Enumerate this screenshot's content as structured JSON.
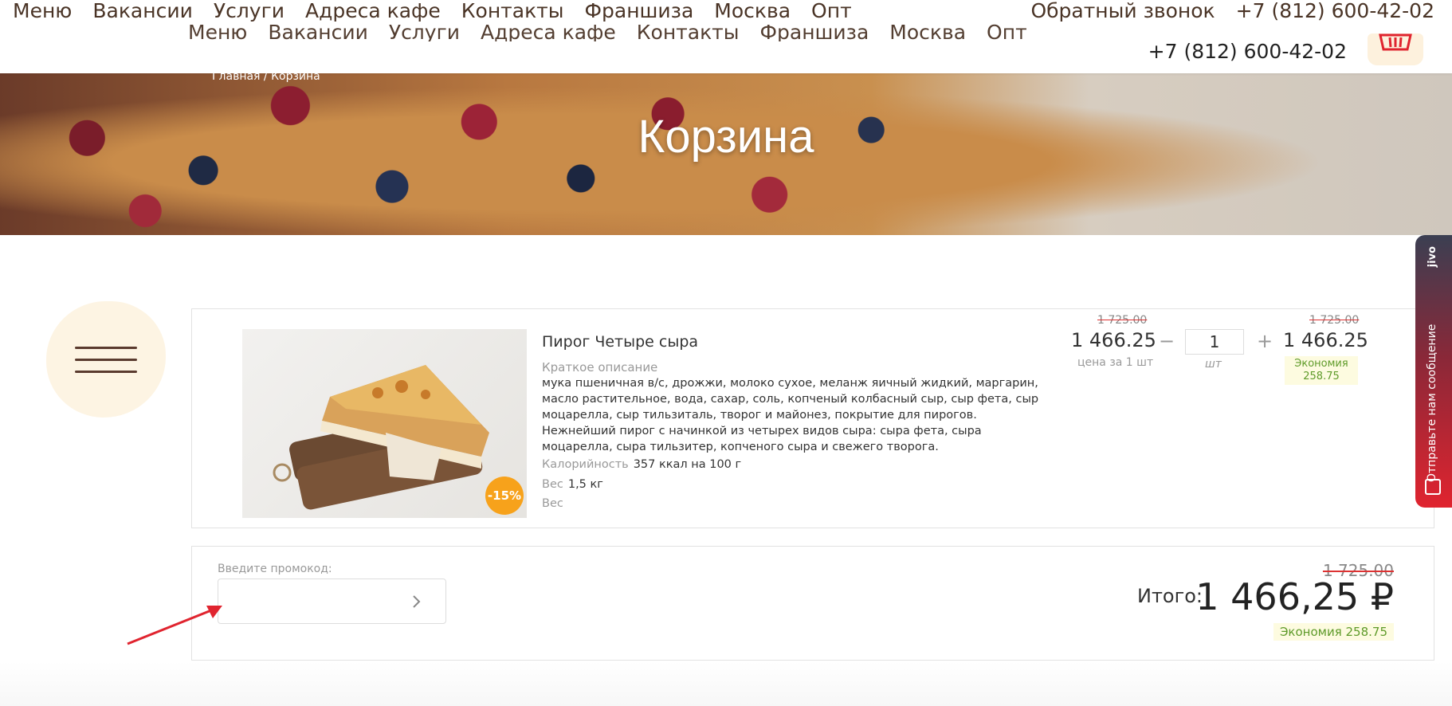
{
  "topnav": {
    "menu": [
      "Меню",
      "Вакансии",
      "Услуги",
      "Адреса кафе",
      "Контакты",
      "Франшиза",
      "Москва",
      "Опт"
    ],
    "callback": "Обратный звонок",
    "phone": "+7 (812) 600-42-02"
  },
  "header": {
    "menu": [
      "Меню",
      "Вакансии",
      "Услуги",
      "Адреса кафе",
      "Контакты",
      "Франшиза",
      "Москва",
      "Опт"
    ],
    "phone": "+7 (812) 600-42-02"
  },
  "hero": {
    "breadcrumb": "Главная / Корзина",
    "title": "Корзина"
  },
  "item": {
    "name": "Пирог Четыре сыра",
    "desc_label": "Краткое описание",
    "description": "мука пшеничная в/с, дрожжи, молоко сухое, меланж яичный жидкий, маргарин, масло растительное, вода, сахар, соль, копченый колбасный сыр, сыр фета, сыр моцарелла, сыр тильзиталь, творог и майонез, покрытие для пирогов. Нежнейший  пирог с начинкой из четырех видов сыра: сыра фета, сыра моцарелла, сыра тильзитер, копченого сыра и свежего творога.",
    "calories_label": "Калорийность",
    "calories": "357 ккал на 100 г",
    "weight_label": "Вес",
    "weight": "1,5 кг",
    "weight_label2": "Вес",
    "discount_badge": "-15%",
    "old_price": "1 725.00",
    "price": "1 466.25",
    "price_unit": "цена за 1 шт",
    "minus": "−",
    "plus": "+",
    "quantity": "1",
    "quantity_unit": "шт",
    "total_old": "1 725.00",
    "total": "1 466.25",
    "savings": "Экономия 258.75"
  },
  "promo": {
    "label": "Введите промокод:",
    "value": "",
    "submit_icon": "chevron-right-icon"
  },
  "summary": {
    "old_total": "1 725.00",
    "label": "Итого:",
    "total": "1 466,25 ₽",
    "savings": "Экономия 258.75"
  },
  "jivo": {
    "text": "Отправьте нам сообщение",
    "logo": "jivo"
  },
  "colors": {
    "brand_brown": "#4a3426",
    "badge_orange": "#f7a21b",
    "savings_green": "#5f9b2a",
    "arrow_red": "#e0242f"
  }
}
